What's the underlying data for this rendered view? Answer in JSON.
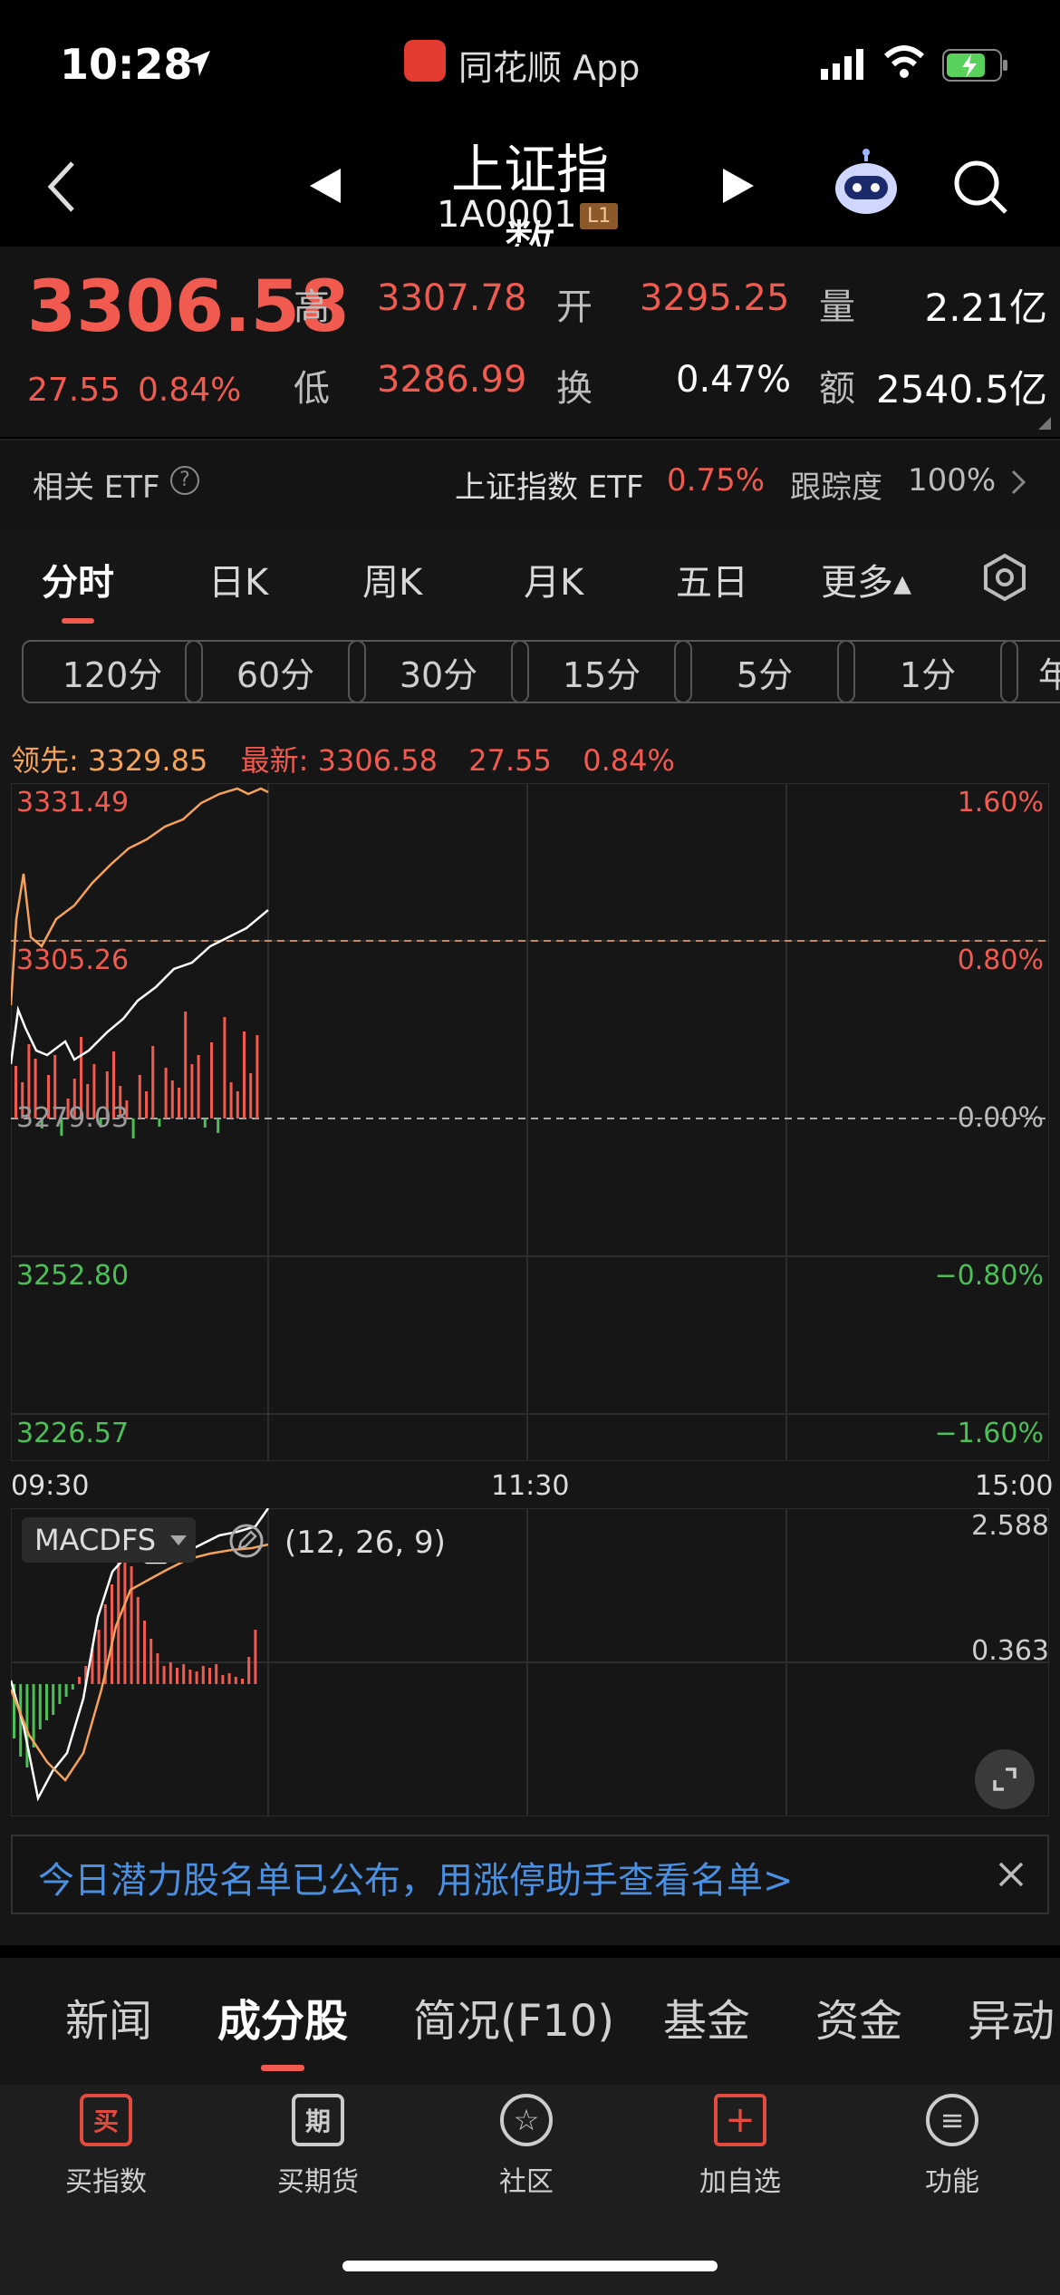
{
  "status_bar": {
    "time": "10:28",
    "app_label": "同花顺 App"
  },
  "header": {
    "title": "上证指数",
    "code": "1A0001",
    "level_badge": "L1"
  },
  "quote": {
    "price": "3306.58",
    "change": "27.55",
    "change_pct": "0.84%",
    "high_label": "高",
    "high": "3307.78",
    "open_label": "开",
    "open": "3295.25",
    "volume_label": "量",
    "volume": "2.21亿",
    "low_label": "低",
    "low": "3286.99",
    "turnover_label": "换",
    "turnover": "0.47%",
    "amount_label": "额",
    "amount": "2540.5亿"
  },
  "etf_bar": {
    "label": "相关 ETF",
    "etf_name": "上证指数 ETF",
    "etf_pct": "0.75%",
    "tracking_label": "跟踪度",
    "tracking_value": "100%"
  },
  "tabs": [
    "分时",
    "日K",
    "周K",
    "月K",
    "五日",
    "更多▴"
  ],
  "timeframes": [
    "120分",
    "60分",
    "30分",
    "15分",
    "5分",
    "1分",
    "年"
  ],
  "legend_line": {
    "lead_label": "领先:",
    "lead_value": "3329.85",
    "latest_label": "最新:",
    "latest_value": "3306.58",
    "change": "27.55",
    "change_pct": "0.84%"
  },
  "price_axis": {
    "left": [
      "3331.49",
      "3305.26",
      "3279.03",
      "3252.80",
      "3226.57"
    ],
    "right": [
      "1.60%",
      "0.80%",
      "0.00%",
      "−0.80%",
      "−1.60%"
    ]
  },
  "time_axis": [
    "09:30",
    "11:30",
    "15:00"
  ],
  "macd": {
    "indicator": "MACDFS",
    "params": "(12, 26, 9)",
    "ticks": [
      "2.588",
      "0.363"
    ]
  },
  "banner": {
    "text": "今日潜力股名单已公布，用涨停助手查看名单>"
  },
  "bottom_tabs": [
    "新闻",
    "成分股",
    "简况(F10)",
    "基金",
    "资金",
    "异动"
  ],
  "bottom_nav": [
    {
      "label": "买指数",
      "icon": "买"
    },
    {
      "label": "买期货",
      "icon": "期"
    },
    {
      "label": "社区",
      "icon": "☆"
    },
    {
      "label": "加自选",
      "icon": "+"
    },
    {
      "label": "功能",
      "icon": "≡"
    }
  ],
  "colors": {
    "up": "#f05a4f",
    "down": "#4cbf57",
    "lead_line": "#f5a25a",
    "price_line": "#ffffff"
  }
}
